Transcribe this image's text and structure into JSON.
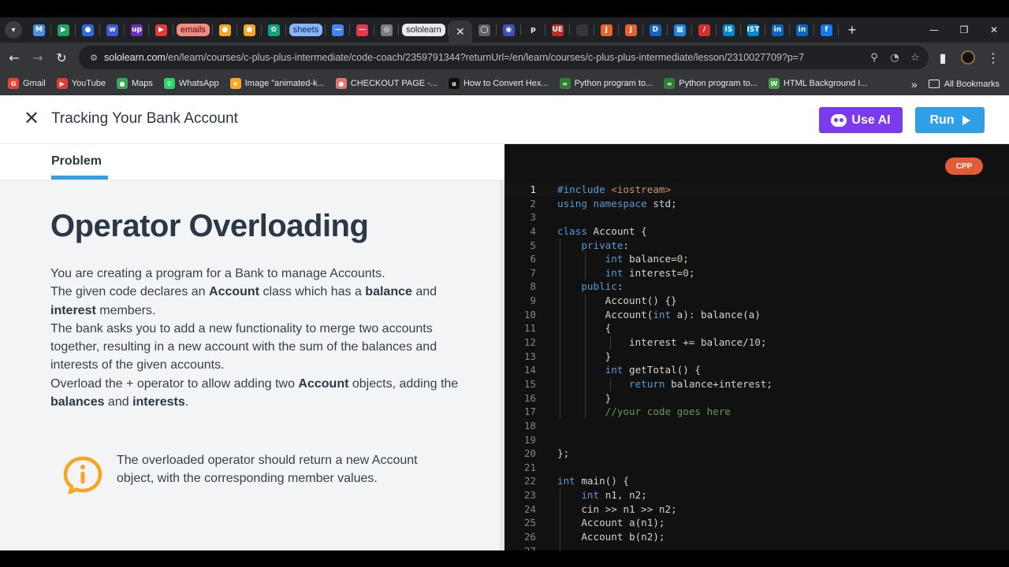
{
  "browser": {
    "tabs": [
      {
        "kind": "icon",
        "name": "gmail-tab",
        "glyph": "M",
        "color": "#4a90e2"
      },
      {
        "kind": "icon",
        "name": "play-tab",
        "glyph": "▶",
        "color": "#1ea362"
      },
      {
        "kind": "icon",
        "name": "circle-tab",
        "glyph": "●",
        "color": "#2d6be0"
      },
      {
        "kind": "icon",
        "name": "w-tab",
        "glyph": "w",
        "color": "#3b5bdb"
      },
      {
        "kind": "icon",
        "name": "upwork-tab",
        "glyph": "up",
        "color": "#6b2fbf"
      },
      {
        "kind": "icon",
        "name": "youtube-tab",
        "glyph": "▶",
        "color": "#e53935"
      },
      {
        "kind": "pill",
        "name": "emails-group",
        "label": "emails",
        "bg": "#f28b82",
        "fg": "#3c0d0d"
      },
      {
        "kind": "icon",
        "name": "map-pin-tab",
        "glyph": "●",
        "color": "#f5a623"
      },
      {
        "kind": "icon",
        "name": "map-pin-tab-2",
        "glyph": "●",
        "color": "#f5a623"
      },
      {
        "kind": "icon",
        "name": "chatgpt-tab",
        "glyph": "✿",
        "color": "#10a37f"
      },
      {
        "kind": "pill",
        "name": "sheets-group",
        "label": "sheets",
        "bg": "#8ab4f8",
        "fg": "#0b2a5a"
      },
      {
        "kind": "icon",
        "name": "blue-bar-tab",
        "glyph": "—",
        "color": "#4285f4"
      },
      {
        "kind": "icon",
        "name": "red-bar-tab",
        "glyph": "—",
        "color": "#e53950"
      },
      {
        "kind": "icon",
        "name": "compass-tab",
        "glyph": "◎",
        "color": "#7a7d82"
      },
      {
        "kind": "pill",
        "name": "sololearn-group",
        "label": "sololearn",
        "bg": "#e8eaed",
        "fg": "#202124"
      },
      {
        "kind": "active",
        "name": "active-tab"
      },
      {
        "kind": "icon",
        "name": "ring-tab",
        "glyph": "◯",
        "color": "#5f6368"
      },
      {
        "kind": "icon",
        "name": "globe-tab",
        "glyph": "◉",
        "color": "#3f51b5"
      },
      {
        "kind": "icon",
        "name": "p-tab",
        "glyph": "p",
        "color": "#202124"
      },
      {
        "kind": "icon",
        "name": "ue-tab",
        "glyph": "UE",
        "color": "#c62828"
      },
      {
        "kind": "icon",
        "name": "blank-tab",
        "glyph": "",
        "color": "#35363a"
      },
      {
        "kind": "icon",
        "name": "j-tab",
        "glyph": "J",
        "color": "#e8642c"
      },
      {
        "kind": "icon",
        "name": "j-tab-2",
        "glyph": "J",
        "color": "#e8642c"
      },
      {
        "kind": "icon",
        "name": "d-tab",
        "glyph": "D",
        "color": "#1565c0"
      },
      {
        "kind": "icon",
        "name": "grid-tab",
        "glyph": "▦",
        "color": "#1e88e5"
      },
      {
        "kind": "icon",
        "name": "slash-tab",
        "glyph": "/",
        "color": "#d32f2f"
      },
      {
        "kind": "icon",
        "name": "is-tab",
        "glyph": "IS",
        "color": "#0288d1"
      },
      {
        "kind": "icon",
        "name": "ist-tab",
        "glyph": "IST",
        "color": "#0288d1"
      },
      {
        "kind": "icon",
        "name": "linkedin-tab",
        "glyph": "in",
        "color": "#0a66c2"
      },
      {
        "kind": "icon",
        "name": "linkedin-tab-2",
        "glyph": "in",
        "color": "#0a66c2"
      },
      {
        "kind": "icon",
        "name": "facebook-tab",
        "glyph": "f",
        "color": "#1877f2"
      }
    ],
    "url_host": "sololearn.com",
    "url_path": "/en/learn/courses/c-plus-plus-intermediate/code-coach/2359791344?returnUrl=/en/learn/courses/c-plus-plus-intermediate/lesson/2310027709?p=7",
    "bookmarks": [
      {
        "name": "bookmark-gmail",
        "label": "Gmail",
        "glyph": "G",
        "color": "#ea4335"
      },
      {
        "name": "bookmark-youtube",
        "label": "YouTube",
        "glyph": "▶",
        "color": "#e53935"
      },
      {
        "name": "bookmark-maps",
        "label": "Maps",
        "glyph": "●",
        "color": "#34a853"
      },
      {
        "name": "bookmark-whatsapp",
        "label": "WhatsApp",
        "glyph": "✆",
        "color": "#25d366"
      },
      {
        "name": "bookmark-image",
        "label": "Image \"animated-k...",
        "glyph": "★",
        "color": "#f9a825"
      },
      {
        "name": "bookmark-checkout",
        "label": "CHECKOUT PAGE -...",
        "glyph": "●",
        "color": "#e57373"
      },
      {
        "name": "bookmark-hex",
        "label": "How to Convert Hex...",
        "glyph": "α",
        "color": "#111111"
      },
      {
        "name": "bookmark-python-1",
        "label": "Python program to...",
        "glyph": "∞",
        "color": "#2e7d32"
      },
      {
        "name": "bookmark-python-2",
        "label": "Python program to...",
        "glyph": "∞",
        "color": "#2e7d32"
      },
      {
        "name": "bookmark-html-bg",
        "label": "HTML Background I...",
        "glyph": "W",
        "color": "#43a047"
      }
    ],
    "all_bookmarks": "All Bookmarks",
    "more_glyph": "»"
  },
  "header": {
    "title": "Tracking Your Bank Account",
    "use_ai_label": "Use AI",
    "run_label": "Run"
  },
  "problem": {
    "tab_label": "Problem",
    "heading": "Operator Overloading",
    "paragraph": [
      {
        "t": "You are creating a program for a Bank to manage Accounts."
      },
      {
        "br": true
      },
      {
        "t": "The given code declares an "
      },
      {
        "b": "Account"
      },
      {
        "t": " class which has a "
      },
      {
        "b": "balance"
      },
      {
        "t": " and "
      },
      {
        "br": true
      },
      {
        "b": "interest"
      },
      {
        "t": " members."
      },
      {
        "br": true
      },
      {
        "t": "The bank asks you to add a new functionality to merge two accounts together, resulting in a new account with the sum of the balances and interests of the given accounts."
      },
      {
        "br": true
      },
      {
        "t": "Overload the + operator to allow adding two "
      },
      {
        "b": "Account"
      },
      {
        "t": " objects, adding the "
      },
      {
        "b": "balances"
      },
      {
        "t": " and "
      },
      {
        "b": "interests"
      },
      {
        "t": "."
      }
    ],
    "callout": "The overloaded operator should return a new Account object, with the corresponding member values.",
    "accent_color": "#f5a623"
  },
  "editor": {
    "language_badge": "CPP",
    "lines": [
      [
        [
          "inc",
          "#include "
        ],
        [
          "str",
          "<iostream>"
        ]
      ],
      [
        [
          "kw",
          "using namespace "
        ],
        [
          "",
          "std;"
        ]
      ],
      [],
      [
        [
          "kw",
          "class "
        ],
        [
          "",
          "Account {"
        ]
      ],
      [
        [
          "",
          "    "
        ],
        [
          "kw",
          "private"
        ],
        [
          "",
          ":"
        ]
      ],
      [
        [
          "",
          "        "
        ],
        [
          "kw",
          "int "
        ],
        [
          "",
          "balance="
        ],
        [
          "num",
          "0"
        ],
        [
          "",
          ";"
        ]
      ],
      [
        [
          "",
          "        "
        ],
        [
          "kw",
          "int "
        ],
        [
          "",
          "interest="
        ],
        [
          "num",
          "0"
        ],
        [
          "",
          ";"
        ]
      ],
      [
        [
          "",
          "    "
        ],
        [
          "kw",
          "public"
        ],
        [
          "",
          ":"
        ]
      ],
      [
        [
          "",
          "        Account() {}"
        ]
      ],
      [
        [
          "",
          "        Account("
        ],
        [
          "kw",
          "int "
        ],
        [
          "",
          "a): balance(a)"
        ]
      ],
      [
        [
          "",
          "        {"
        ]
      ],
      [
        [
          "",
          "            interest += balance/"
        ],
        [
          "num",
          "10"
        ],
        [
          "",
          ";"
        ]
      ],
      [
        [
          "",
          "        }"
        ]
      ],
      [
        [
          "",
          "        "
        ],
        [
          "kw",
          "int "
        ],
        [
          "",
          "getTotal() {"
        ]
      ],
      [
        [
          "",
          "            "
        ],
        [
          "kw",
          "return "
        ],
        [
          "",
          "balance+interest;"
        ]
      ],
      [
        [
          "",
          "        }"
        ]
      ],
      [
        [
          "",
          "        "
        ],
        [
          "cm",
          "//your code goes here"
        ]
      ],
      [],
      [],
      [
        [
          "",
          "};"
        ]
      ],
      [],
      [
        [
          "kw",
          "int "
        ],
        [
          "",
          "main() {"
        ]
      ],
      [
        [
          "",
          "    "
        ],
        [
          "kw",
          "int "
        ],
        [
          "",
          "n1, n2;"
        ]
      ],
      [
        [
          "",
          "    cin >> n1 >> n2;"
        ]
      ],
      [
        [
          "",
          "    Account a(n1);"
        ]
      ],
      [
        [
          "",
          "    Account b(n2);"
        ]
      ],
      [
        [
          "",
          "    "
        ]
      ]
    ]
  }
}
